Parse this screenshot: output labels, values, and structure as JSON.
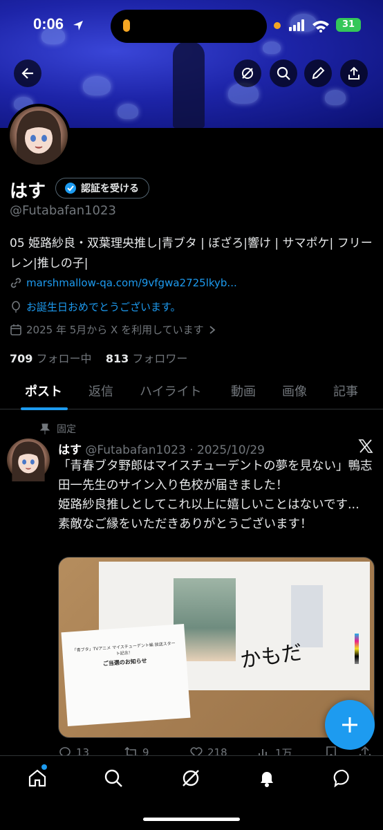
{
  "status_bar": {
    "time": "0:06",
    "battery": "31"
  },
  "profile": {
    "name": "はす",
    "verify_label": "認証を受ける",
    "handle": "@Futabafan1023",
    "bio": "05 姫路紗良・双葉理央推し|青ブタ | ぼざろ|響け | サマポケ| フリーレン|推しの子|",
    "link": "marshmallow-qa.com/9vfgwa2725lkyb...",
    "birthday": "お誕生日おめでとうございます。",
    "joined": "2025 年 5月から X を利用しています",
    "following_count": "709",
    "following_label": "フォロー中",
    "followers_count": "813",
    "followers_label": "フォロワー"
  },
  "tabs": [
    "ポスト",
    "返信",
    "ハイライト",
    "動画",
    "画像",
    "記事"
  ],
  "post": {
    "pinned_label": "固定",
    "name": "はす",
    "meta": "@Futabafan1023 · 2025/10/29",
    "text": "「青春ブタ野郎はマイスチューデントの夢を見ない」鴨志田一先生のサイン入り色校が届きました！\n姫路紗良推しとしてこれ以上に嬉しいことはないです...\n素敵なご縁をいただきありがとうございます！",
    "image_text": {
      "card_line1": "「青ブタ」TVアニメ マイスチューデント編 放送スタート記念！",
      "card_line2": "ご当選のお知らせ",
      "signature": "かもだ"
    },
    "counts": {
      "replies": "13",
      "reposts": "9",
      "likes": "218",
      "views": "1万"
    }
  },
  "colors": {
    "accent": "#1d9bf0",
    "background": "#000000",
    "text": "#e7e9ea",
    "muted": "#71767b"
  },
  "icons": [
    "back-arrow-icon",
    "grok-icon",
    "search-icon",
    "edit-icon",
    "share-icon",
    "link-icon",
    "balloon-icon",
    "calendar-icon",
    "pin-icon",
    "x-logo-icon",
    "reply-icon",
    "repost-icon",
    "like-icon",
    "views-icon",
    "bookmark-icon",
    "compose-plus-icon",
    "home-icon",
    "notifications-icon",
    "messages-icon"
  ]
}
